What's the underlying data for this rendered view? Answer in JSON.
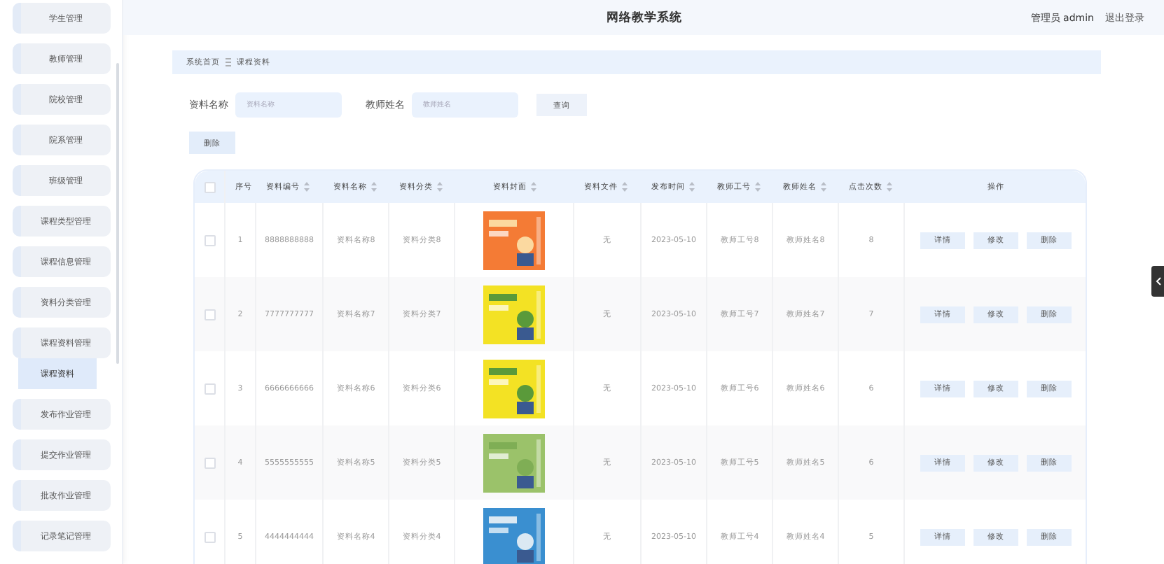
{
  "header": {
    "title": "网络教学系统",
    "user": "管理员 admin",
    "logout": "退出登录"
  },
  "sidebar": {
    "items": [
      {
        "label": "学生管理"
      },
      {
        "label": "教师管理"
      },
      {
        "label": "院校管理"
      },
      {
        "label": "院系管理"
      },
      {
        "label": "班级管理"
      },
      {
        "label": "课程类型管理"
      },
      {
        "label": "课程信息管理"
      },
      {
        "label": "资料分类管理"
      },
      {
        "label": "课程资料管理",
        "children": [
          {
            "label": "课程资料",
            "selected": true
          }
        ]
      },
      {
        "label": "发布作业管理"
      },
      {
        "label": "提交作业管理"
      },
      {
        "label": "批改作业管理"
      },
      {
        "label": "记录笔记管理"
      }
    ]
  },
  "breadcrumb": [
    "系统首页",
    "课程资料"
  ],
  "search": {
    "fields": [
      {
        "label": "资料名称",
        "placeholder": "资料名称"
      },
      {
        "label": "教师姓名",
        "placeholder": "教师姓名"
      }
    ],
    "button": "查询"
  },
  "delete_button": "删除",
  "table": {
    "all_checked": false,
    "columns": [
      "序号",
      "资料编号",
      "资料名称",
      "资料分类",
      "资料封面",
      "资料文件",
      "发布时间",
      "教师工号",
      "教师姓名",
      "点击次数",
      "操作"
    ],
    "rows": [
      {
        "index": "1",
        "code": "8888888888",
        "name": "资料名称8",
        "category": "资料分类8",
        "file": "无",
        "date": "2023-05-10",
        "teacher_id": "教师工号8",
        "teacher": "教师姓名8",
        "clicks": "8",
        "checked": false,
        "actions": [
          "详情",
          "修改",
          "删除"
        ]
      },
      {
        "index": "2",
        "code": "7777777777",
        "name": "资料名称7",
        "category": "资料分类7",
        "file": "无",
        "date": "2023-05-10",
        "teacher_id": "教师工号7",
        "teacher": "教师姓名7",
        "clicks": "7",
        "checked": false,
        "actions": [
          "详情",
          "修改",
          "删除"
        ]
      },
      {
        "index": "3",
        "code": "6666666666",
        "name": "资料名称6",
        "category": "资料分类6",
        "file": "无",
        "date": "2023-05-10",
        "teacher_id": "教师工号6",
        "teacher": "教师姓名6",
        "clicks": "6",
        "checked": false,
        "actions": [
          "详情",
          "修改",
          "删除"
        ]
      },
      {
        "index": "4",
        "code": "5555555555",
        "name": "资料名称5",
        "category": "资料分类5",
        "file": "无",
        "date": "2023-05-10",
        "teacher_id": "教师工号5",
        "teacher": "教师姓名5",
        "clicks": "6",
        "checked": false,
        "actions": [
          "详情",
          "修改",
          "删除"
        ]
      },
      {
        "index": "5",
        "code": "4444444444",
        "name": "资料名称4",
        "category": "资料分类4",
        "file": "无",
        "date": "2023-05-10",
        "teacher_id": "教师工号4",
        "teacher": "教师姓名4",
        "clicks": "5",
        "checked": false,
        "actions": [
          "详情",
          "修改",
          "删除"
        ]
      }
    ]
  }
}
